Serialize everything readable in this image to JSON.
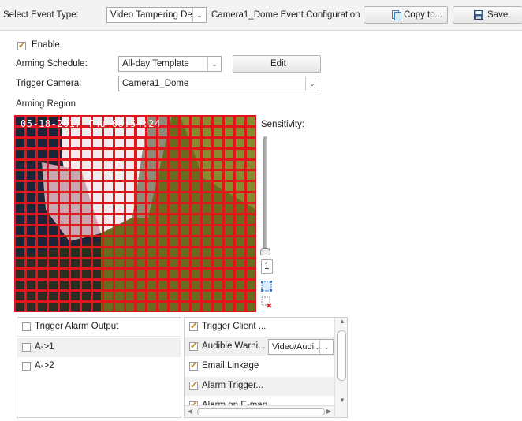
{
  "toolbar": {
    "event_type_label": "Select Event Type:",
    "event_type_value": "Video Tampering De...",
    "config_title": "Camera1_Dome Event Configuration",
    "copy_label": "Copy to...",
    "save_label": "Save"
  },
  "enable": {
    "label": "Enable",
    "checked": true
  },
  "arming_schedule": {
    "label": "Arming Schedule:",
    "value": "All-day Template",
    "edit_label": "Edit"
  },
  "trigger_camera": {
    "label": "Trigger Camera:",
    "value": "Camera1_Dome"
  },
  "arming_region": {
    "label": "Arming Region",
    "timestamp_overlay": "05-18-2017 Thu 08:54:24",
    "sensitivity_label": "Sensitivity:",
    "sensitivity_value": "1"
  },
  "alarm_output": {
    "header": "Trigger Alarm Output",
    "items": [
      {
        "label": "A->1",
        "checked": false
      },
      {
        "label": "A->2",
        "checked": false
      }
    ]
  },
  "linkage": {
    "items": [
      {
        "label": "Trigger Client ...",
        "checked": true
      },
      {
        "label": "Audible Warni...",
        "checked": true,
        "select_value": "Video/Audi..."
      },
      {
        "label": "Email Linkage",
        "checked": true
      },
      {
        "label": "Alarm Trigger...",
        "checked": true
      },
      {
        "label": "Alarm on E-map",
        "checked": true
      }
    ]
  },
  "colors": {
    "grid_red": "#e0161b",
    "check_orange": "#c27a00"
  }
}
